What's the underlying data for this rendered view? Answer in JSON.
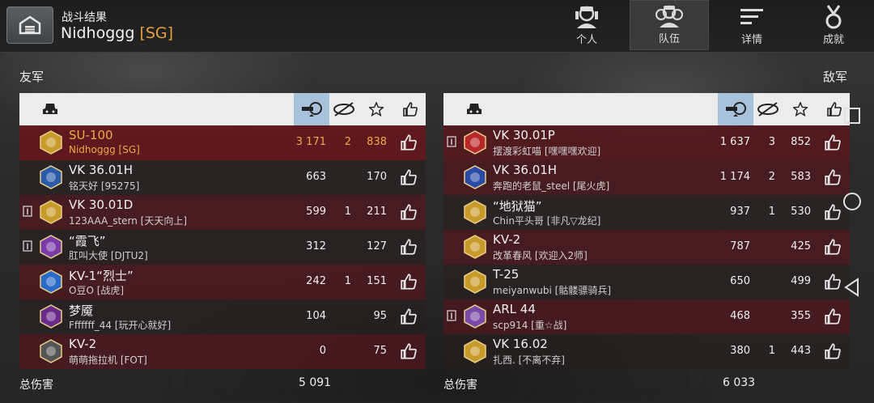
{
  "header": {
    "subtitle": "战斗结果",
    "player_name": "Nidhoggg",
    "player_clan": "[SG]",
    "tabs": [
      {
        "label": "个人",
        "icon": "tank-crew-icon",
        "active": false
      },
      {
        "label": "队伍",
        "icon": "team-icon",
        "active": true
      },
      {
        "label": "详情",
        "icon": "details-icon",
        "active": false
      },
      {
        "label": "成就",
        "icon": "medal-icon",
        "active": false
      }
    ]
  },
  "allies": {
    "label": "友军",
    "total_label": "总伤害",
    "total_damage": "5 091",
    "rows": [
      {
        "tank": "SU-100",
        "player": "Nidhoggg [SG]",
        "damage": "3 171",
        "kills": "2",
        "score": "838",
        "platoon": false,
        "mine": true
      },
      {
        "tank": "VK 36.01H",
        "player": "铭天好 [95275]",
        "damage": "663",
        "kills": "",
        "score": "170",
        "platoon": false,
        "mine": false
      },
      {
        "tank": "VK 30.01D",
        "player": "123AAA_stern [天天向上]",
        "damage": "599",
        "kills": "1",
        "score": "211",
        "platoon": true,
        "mine": false
      },
      {
        "tank": "“霞飞”",
        "player": "肛叫大使 [DJTU2]",
        "damage": "312",
        "kills": "",
        "score": "127",
        "platoon": true,
        "mine": false
      },
      {
        "tank": "KV-1“烈士”",
        "player": "O豆O [战虎]",
        "damage": "242",
        "kills": "1",
        "score": "151",
        "platoon": false,
        "mine": false
      },
      {
        "tank": "梦魇",
        "player": "Fffffff_44 [玩开心就好]",
        "damage": "104",
        "kills": "",
        "score": "95",
        "platoon": false,
        "mine": false
      },
      {
        "tank": "KV-2",
        "player": "萌萌拖拉机 [FOT]",
        "damage": "0",
        "kills": "",
        "score": "75",
        "platoon": false,
        "mine": false
      }
    ]
  },
  "enemies": {
    "label": "敌军",
    "total_label": "总伤害",
    "total_damage": "6 033",
    "rows": [
      {
        "tank": "VK 30.01P",
        "player": "摆渡彩虹喵 [嘿嘿嘿欢迎]",
        "damage": "1 637",
        "kills": "3",
        "score": "852",
        "platoon": true
      },
      {
        "tank": "VK 36.01H",
        "player": "奔跑的老鼠_steel [尾火虎]",
        "damage": "1 174",
        "kills": "2",
        "score": "583",
        "platoon": false
      },
      {
        "tank": "“地狱猫”",
        "player": "Chin平头哥 [非凡▽龙纪]",
        "damage": "937",
        "kills": "1",
        "score": "530",
        "platoon": false
      },
      {
        "tank": "KV-2",
        "player": "改革春风 [欢迎入2师]",
        "damage": "787",
        "kills": "",
        "score": "425",
        "platoon": false
      },
      {
        "tank": "T-25",
        "player": "meiyanwubi [骷髅骠骑兵]",
        "damage": "650",
        "kills": "",
        "score": "499",
        "platoon": false
      },
      {
        "tank": "ARL 44",
        "player": "scp914 [重☆战]",
        "damage": "468",
        "kills": "",
        "score": "355",
        "platoon": true
      },
      {
        "tank": "VK 16.02",
        "player": "扎西. [不离不弃]",
        "damage": "380",
        "kills": "1",
        "score": "443",
        "platoon": false
      }
    ]
  },
  "colors": {
    "accent": "#e8a03a",
    "sorted_column": "#a9c2dc",
    "row_red": "#5f141a"
  }
}
